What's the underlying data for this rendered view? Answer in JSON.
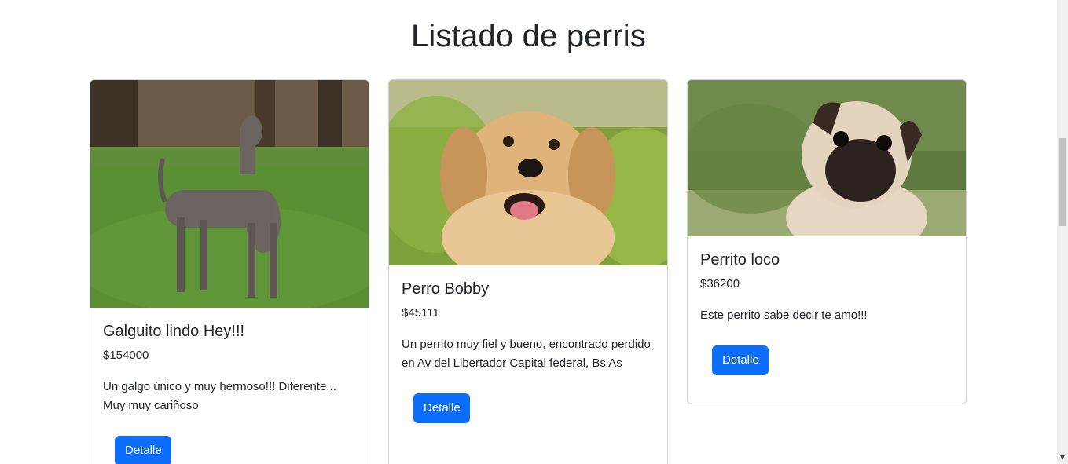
{
  "page": {
    "title": "Listado de perris"
  },
  "cards": [
    {
      "title": "Galguito lindo Hey!!!",
      "price": "$154000",
      "description": "Un galgo único y muy hermoso!!! Diferente... Muy muy cariñoso",
      "button_label": "Detalle",
      "image": "greyhound-dog-photo"
    },
    {
      "title": "Perro Bobby",
      "price": "$45111",
      "description": "Un perrito muy fiel y bueno, encontrado perdido en Av del Libertador Capital federal, Bs As",
      "button_label": "Detalle",
      "image": "golden-retriever-photo"
    },
    {
      "title": "Perrito loco",
      "price": "$36200",
      "description": "Este perrito sabe decir te amo!!!",
      "button_label": "Detalle",
      "image": "pug-photo"
    }
  ],
  "colors": {
    "primary_button": "#0d6efd",
    "text": "#212529",
    "card_border": "#dee2e6"
  }
}
